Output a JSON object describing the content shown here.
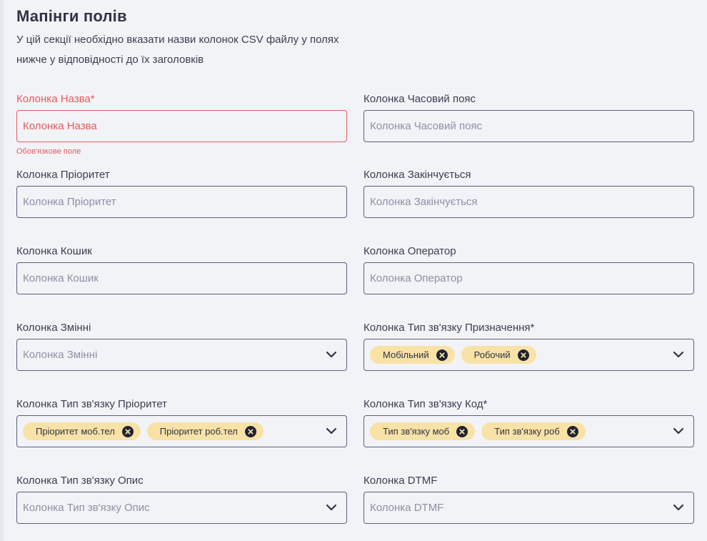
{
  "header": {
    "title": "Мапінги полів",
    "description": "У цій секції необхідно вказати назви колонок CSV файлу у полях нижче у відповідності до їх заголовків"
  },
  "fields": {
    "name": {
      "label": "Колонка Назва*",
      "placeholder": "Колонка Назва",
      "error": "Обов'язкове поле"
    },
    "timezone": {
      "label": "Колонка Часовий пояс",
      "placeholder": "Колонка Часовий пояс"
    },
    "priority": {
      "label": "Колонка Пріоритет",
      "placeholder": "Колонка Пріоритет"
    },
    "ends": {
      "label": "Колонка Закінчується",
      "placeholder": "Колонка Закінчується"
    },
    "basket": {
      "label": "Колонка Кошик",
      "placeholder": "Колонка Кошик"
    },
    "operator": {
      "label": "Колонка Оператор",
      "placeholder": "Колонка Оператор"
    },
    "variables": {
      "label": "Колонка Змінні",
      "placeholder": "Колонка Змінні"
    },
    "comm_type_purpose": {
      "label": "Колонка Тип зв'язку Призначення*",
      "chips": [
        "Мобільний",
        "Робочий"
      ]
    },
    "comm_type_priority": {
      "label": "Колонка Тип зв'язку Пріоритет",
      "chips": [
        "Пріоритет моб.тел",
        "Пріоритет роб.тел"
      ]
    },
    "comm_type_code": {
      "label": "Колонка Тип зв'язку Код*",
      "chips": [
        "Тип зв'язку моб",
        "Тип зв'язку роб"
      ]
    },
    "comm_type_desc": {
      "label": "Колонка Тип зв'язку Опис",
      "placeholder": "Колонка Тип зв'язку Опис"
    },
    "dtmf": {
      "label": "Колонка DTMF",
      "placeholder": "Колонка DTMF"
    }
  },
  "colors": {
    "background": "#f2f3f7",
    "text": "#2f3344",
    "border": "#5b6080",
    "error": "#e25c5c",
    "chip": "#f8e2a6"
  }
}
